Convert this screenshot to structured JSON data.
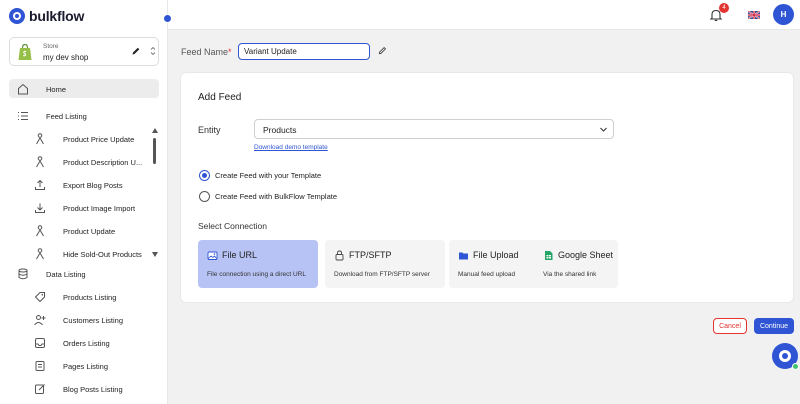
{
  "app": {
    "logo_text": "bulkflow"
  },
  "store": {
    "label": "Store",
    "name": "my dev shop"
  },
  "sidebar": {
    "items": [
      {
        "label": "Home",
        "icon": "home-icon",
        "active": true
      },
      {
        "label": "Feed Listing",
        "icon": "list-icon"
      },
      {
        "label": "Product Price Update",
        "icon": "person-icon"
      },
      {
        "label": "Product Description U...",
        "icon": "person-icon"
      },
      {
        "label": "Export Blog Posts",
        "icon": "upload-icon"
      },
      {
        "label": "Product Image Import",
        "icon": "download-icon"
      },
      {
        "label": "Product Update",
        "icon": "person-icon"
      },
      {
        "label": "Hide Sold-Out Products",
        "icon": "person-icon"
      },
      {
        "label": "Data Listing",
        "icon": "database-icon"
      },
      {
        "label": "Products Listing",
        "icon": "tag-icon"
      },
      {
        "label": "Customers Listing",
        "icon": "user-plus-icon"
      },
      {
        "label": "Orders Listing",
        "icon": "inbox-icon"
      },
      {
        "label": "Pages Listing",
        "icon": "page-icon"
      },
      {
        "label": "Blog Posts Listing",
        "icon": "edit-icon"
      }
    ]
  },
  "topbar": {
    "notification_count": "4",
    "avatar_initial": "H"
  },
  "feed": {
    "name_label": "Feed Name",
    "required_mark": "*",
    "name_value": "Variant Update"
  },
  "card": {
    "title": "Add Feed",
    "entity_label": "Entity",
    "entity_value": "Products",
    "demo_link": "Download demo template",
    "options": [
      {
        "label": "Create Feed with your Template",
        "checked": true
      },
      {
        "label": "Create Feed with BulkFlow Template",
        "checked": false
      }
    ],
    "connection_title": "Select Connection",
    "connections": [
      {
        "name": "File URL",
        "desc": "File connection using a direct URL",
        "selected": true
      },
      {
        "name": "FTP/SFTP",
        "desc": "Download from FTP/SFTP server",
        "selected": false
      },
      {
        "name": "File Upload",
        "desc": "Manual feed upload",
        "selected": false
      },
      {
        "name": "Google Sheet",
        "desc": "Via the shared link",
        "selected": false
      }
    ]
  },
  "actions": {
    "cancel": "Cancel",
    "continue": "Continue"
  },
  "colors": {
    "accent": "#2f55d4",
    "danger": "#e3342f",
    "selected_tile": "#b8c3f5"
  }
}
